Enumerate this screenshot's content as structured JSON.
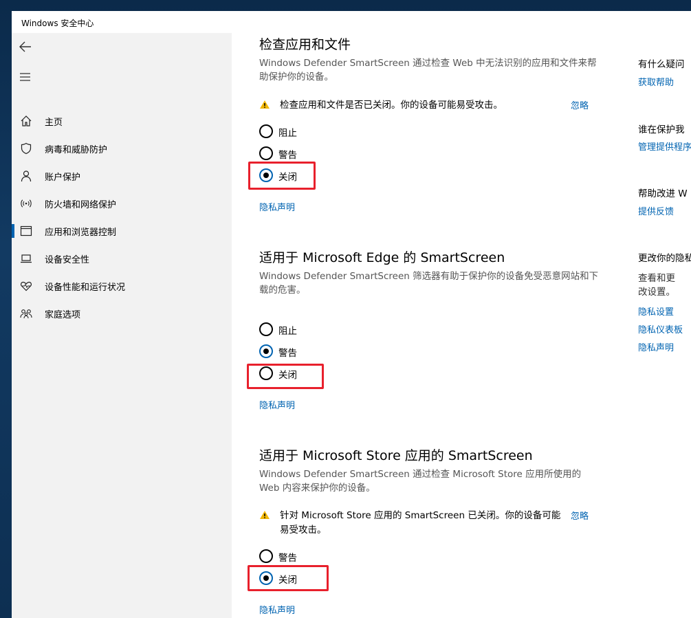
{
  "window": {
    "title": "Windows 安全中心"
  },
  "sidebar": {
    "items": [
      {
        "label": "主页",
        "icon": "home-icon"
      },
      {
        "label": "病毒和威胁防护",
        "icon": "shield-icon"
      },
      {
        "label": "账户保护",
        "icon": "person-icon"
      },
      {
        "label": "防火墙和网络保护",
        "icon": "wireless-icon"
      },
      {
        "label": "应用和浏览器控制",
        "icon": "browser-window-icon",
        "active": true
      },
      {
        "label": "设备安全性",
        "icon": "laptop-icon"
      },
      {
        "label": "设备性能和运行状况",
        "icon": "heart-pulse-icon"
      },
      {
        "label": "家庭选项",
        "icon": "family-icon"
      }
    ]
  },
  "sections": [
    {
      "title": "检查应用和文件",
      "description": "Windows Defender SmartScreen 通过检查 Web 中无法识别的应用和文件来帮助保护你的设备。",
      "warning": "检查应用和文件是否已关闭。你的设备可能易受攻击。",
      "dismiss": "忽略",
      "options": [
        "阻止",
        "警告",
        "关闭"
      ],
      "selected": "关闭",
      "privacy_link": "隐私声明"
    },
    {
      "title": "适用于 Microsoft Edge 的 SmartScreen",
      "description": "Windows Defender SmartScreen 筛选器有助于保护你的设备免受恶意网站和下载的危害。",
      "options": [
        "阻止",
        "警告",
        "关闭"
      ],
      "selected": "警告",
      "privacy_link": "隐私声明"
    },
    {
      "title": "适用于 Microsoft Store 应用的 SmartScreen",
      "description": "Windows Defender SmartScreen 通过检查 Microsoft Store 应用所使用的 Web 内容来保护你的设备。",
      "warning": "针对 Microsoft Store 应用的 SmartScreen 已关闭。你的设备可能易受攻击。",
      "dismiss": "忽略",
      "options": [
        "警告",
        "关闭"
      ],
      "selected": "关闭",
      "privacy_link": "隐私声明"
    }
  ],
  "aside": {
    "questions_heading": "有什么疑问",
    "get_help": "获取帮助",
    "protector_heading": "谁在保护我",
    "manage_providers": "管理提供程序",
    "improve_heading": "帮助改进 W",
    "feedback": "提供反馈",
    "privacy_heading": "更改你的隐私",
    "privacy_text": "查看和更改设置。",
    "privacy_settings": "隐私设置",
    "privacy_dashboard": "隐私仪表板",
    "privacy_statement": "隐私声明"
  },
  "colors": {
    "accent": "#0063b1",
    "highlight": "#e8202c",
    "warning": "#f2b705",
    "sidebar_bg": "#f2f2f2"
  }
}
